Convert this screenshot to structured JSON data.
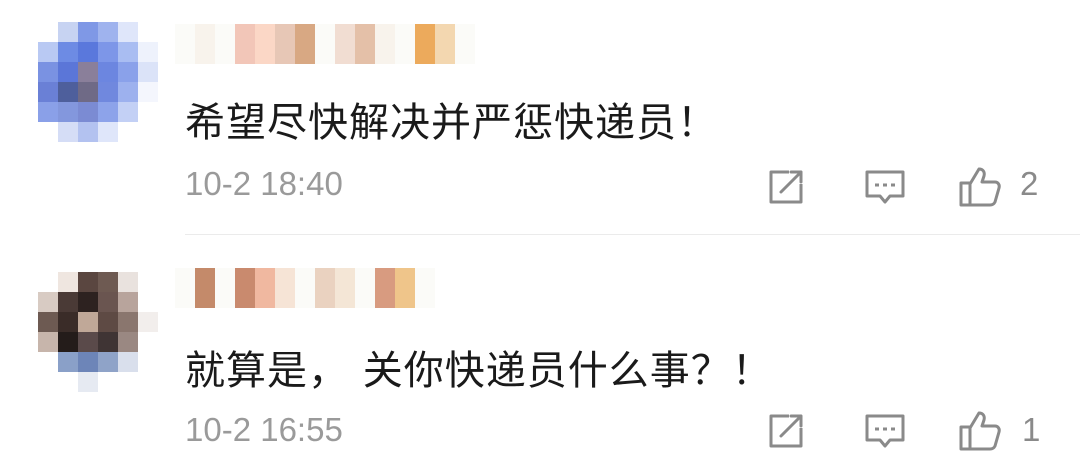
{
  "comments": [
    {
      "text": "希望尽快解决并严惩快递员！",
      "time": "10-2 18:40",
      "likes": "2",
      "avatar_icon": "pixelated-avatar",
      "username_icon": "pixelated-username"
    },
    {
      "text": "就算是， 关你快递员什么事？！",
      "time": "10-2 16:55",
      "likes": "1",
      "avatar_icon": "pixelated-avatar",
      "username_icon": "pixelated-username"
    }
  ],
  "actions": {
    "share_icon": "share-icon",
    "reply_icon": "comment-icon",
    "like_icon": "thumbs-up-icon"
  },
  "colors": {
    "text": "#1a1a1a",
    "meta": "#9a9a9a",
    "icon": "#8a8a8a",
    "divider": "#ebebeb"
  }
}
